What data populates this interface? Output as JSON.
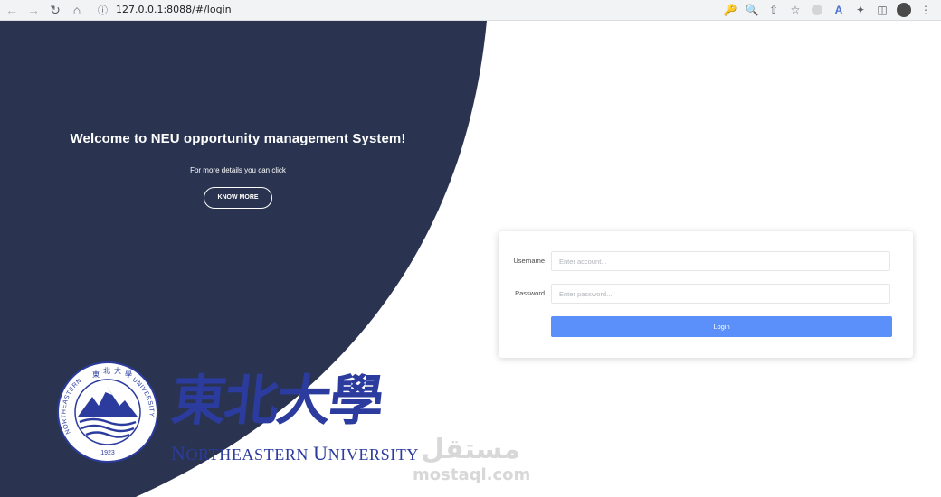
{
  "browser": {
    "url": "127.0.0.1:8088/#/login",
    "icons": [
      "back-icon",
      "forward-icon",
      "reload-icon",
      "home-icon",
      "info-icon",
      "key-icon",
      "zoom-icon",
      "share-icon",
      "star-icon",
      "profile-icon",
      "translate-icon",
      "extensions-icon",
      "sidebar-icon",
      "avatar-icon",
      "menu-icon"
    ]
  },
  "hero": {
    "title": "Welcome to NEU opportunity management System!",
    "subtitle": "For more details you can click",
    "button_label": "KNOW MORE"
  },
  "login": {
    "username_label": "Username",
    "username_placeholder": "Enter account...",
    "password_label": "Password",
    "password_placeholder": "Enter password...",
    "submit_label": "Login"
  },
  "logo": {
    "name_first_initial": "N",
    "name_first_rest": "ORTHEASTERN",
    "name_second_initial": "U",
    "name_second_rest": "NIVERSITY",
    "seal_text_left": "NORTHEASTERN",
    "seal_text_right": "UNIVERSITY",
    "seal_year": "1923",
    "calligraphy": "東北大學"
  },
  "watermark": {
    "arabic": "مستقل",
    "latin": "mostaql.com"
  },
  "colors": {
    "hero_bg": "#2a3450",
    "primary": "#5b8ff9",
    "logo_blue": "#2b3c9e"
  }
}
